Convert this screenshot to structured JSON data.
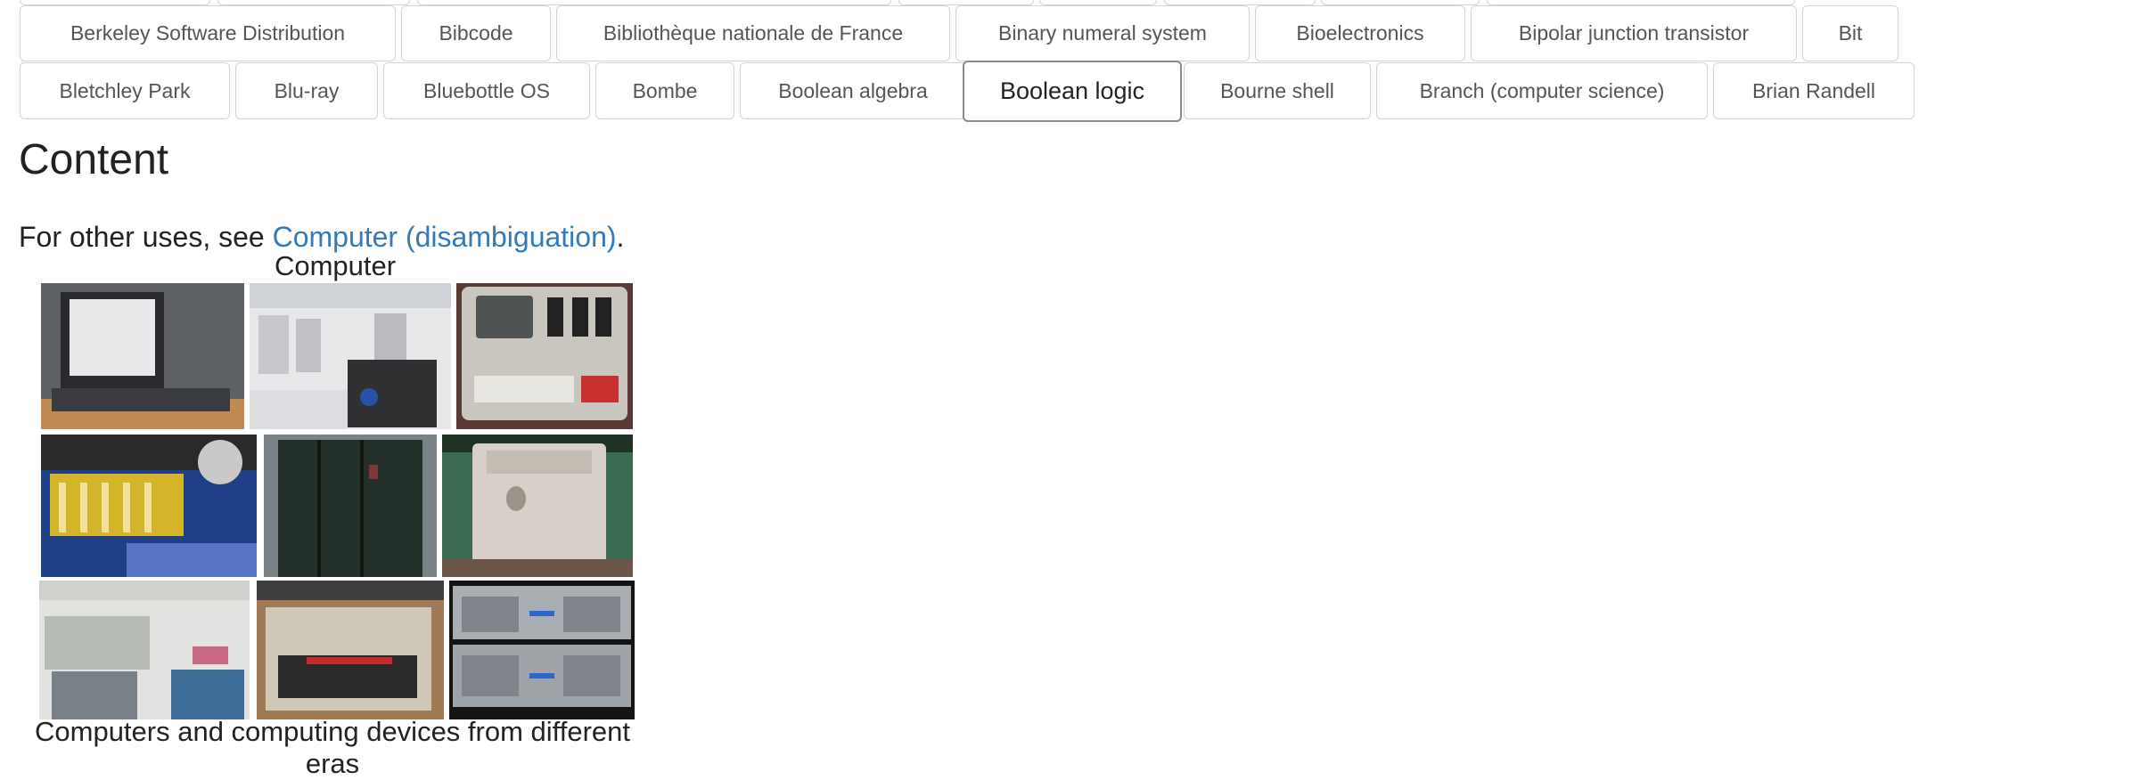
{
  "nav_row_1": [
    "Berkeley Software Distribution",
    "Bibcode",
    "Bibliothèque nationale de France",
    "Binary numeral system",
    "Bioelectronics",
    "Bipolar junction transistor",
    "Bit"
  ],
  "nav_row_2": [
    "Bletchley Park",
    "Blu-ray",
    "Bluebottle OS",
    "Bombe",
    "Boolean algebra",
    "Boolean logic",
    "Bourne shell",
    "Branch (computer science)",
    "Brian Randell"
  ],
  "active_item": "Boolean logic",
  "content": {
    "heading": "Content",
    "hatnote_prefix": "For other uses, see ",
    "hatnote_link": "Computer (disambiguation)",
    "hatnote_suffix": "."
  },
  "infobox": {
    "title": "Computer",
    "caption": "Computers and computing devices from different eras"
  }
}
